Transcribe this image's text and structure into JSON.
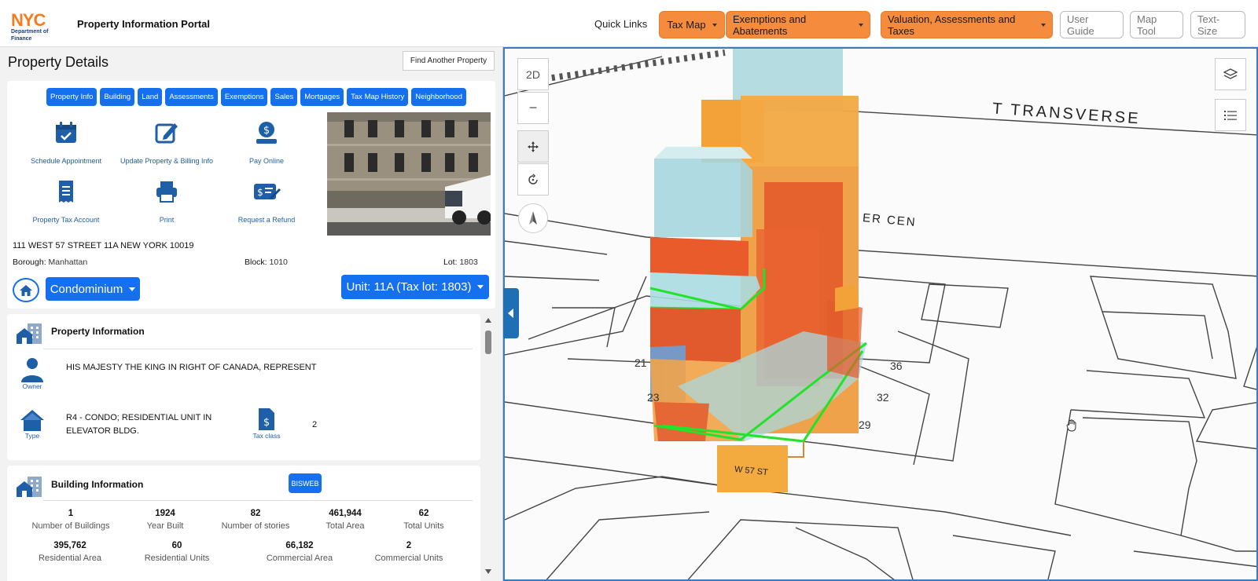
{
  "header": {
    "logo_text": "NYC",
    "logo_subtext": "Department of Finance",
    "portal_title": "Property Information Portal",
    "quick_links": "Quick Links",
    "buttons": [
      {
        "label": "Tax Map"
      },
      {
        "label": "Exemptions and Abatements"
      },
      {
        "label": "Valuation, Assessments and Taxes"
      },
      {
        "label": "User Guide"
      },
      {
        "label": "Map Tool"
      },
      {
        "label": "Text-Size"
      }
    ]
  },
  "details": {
    "title": "Property Details",
    "find_button": "Find Another Property",
    "tabs": [
      "Property Info",
      "Building",
      "Land",
      "Assessments",
      "Exemptions",
      "Sales",
      "Mortgages",
      "Tax Map History",
      "Neighborhood"
    ],
    "actions": [
      {
        "label": "Schedule Appointment",
        "icon": "calendar-check-icon"
      },
      {
        "label": "Update Property & Billing Info",
        "icon": "edit-icon"
      },
      {
        "label": "Pay Online",
        "icon": "pay-online-icon"
      },
      {
        "label": "Property Tax Account",
        "icon": "receipt-icon"
      },
      {
        "label": "Print",
        "icon": "printer-icon"
      },
      {
        "label": "Request a Refund",
        "icon": "refund-icon"
      }
    ],
    "address": "111 WEST 57 STREET 11A NEW YORK 10019",
    "borough_label": "Borough:",
    "borough": "Manhattan",
    "block_label": "Block:",
    "block": "1010",
    "lot_label": "Lot:",
    "lot": "1803",
    "property_type_dropdown": "Condominium",
    "unit_dropdown": "Unit: 11A (Tax lot: 1803)"
  },
  "property_info": {
    "title": "Property Information",
    "owner_label": "Owner",
    "owner": "HIS MAJESTY THE KING IN RIGHT OF CANADA, REPRESENT",
    "type_label": "Type",
    "type": "R4 - CONDO; RESIDENTIAL UNIT IN ELEVATOR BLDG.",
    "tax_class_label": "Tax class",
    "tax_class": "2"
  },
  "building_info": {
    "title": "Building Information",
    "bisweb": "BISWEB",
    "stats": [
      {
        "value": "1",
        "label": "Number of Buildings"
      },
      {
        "value": "1924",
        "label": "Year Built"
      },
      {
        "value": "82",
        "label": "Number of stories"
      },
      {
        "value": "461,944",
        "label": "Total Area"
      },
      {
        "value": "62",
        "label": "Total Units"
      },
      {
        "value": "395,762",
        "label": "Residential Area"
      },
      {
        "value": "60",
        "label": "Residential Units"
      },
      {
        "value": "66,182",
        "label": "Commercial Area"
      },
      {
        "value": "2",
        "label": "Commercial Units"
      }
    ]
  },
  "map": {
    "mode_button": "2D",
    "zoom_out": "−",
    "street_labels": [
      "T TRANSVERSE",
      "ER CEN",
      "W 57 ST"
    ],
    "lot_numbers": [
      "21",
      "23",
      "36",
      "32",
      "29"
    ]
  },
  "colors": {
    "primary_blue": "#1570ef",
    "orange": "#f58b3c",
    "link_blue": "#1f5fa8"
  }
}
